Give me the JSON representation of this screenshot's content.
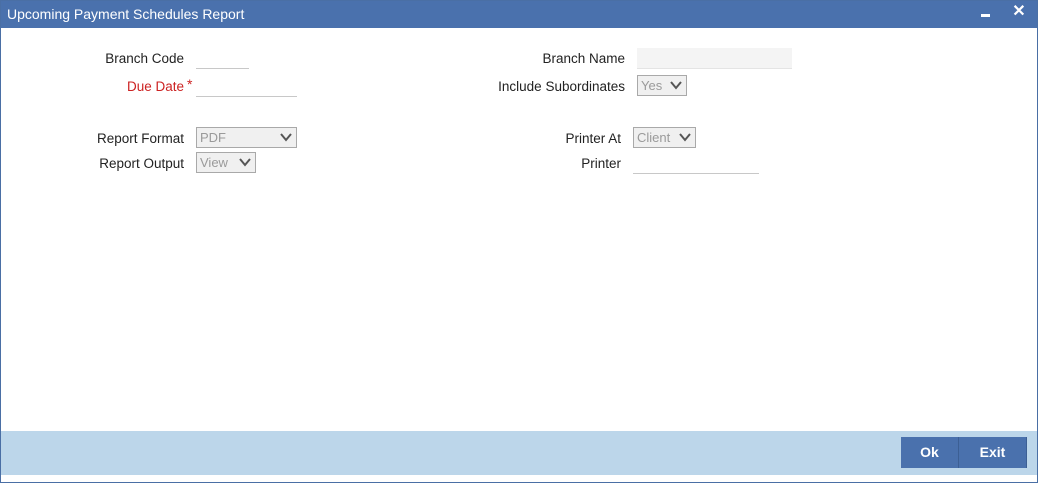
{
  "window": {
    "title": "Upcoming Payment Schedules Report",
    "minimize_icon": "minimize-icon",
    "close_icon": "close-icon",
    "close_glyph": "✕"
  },
  "form": {
    "branch_code": {
      "label": "Branch Code",
      "value": ""
    },
    "due_date": {
      "label": "Due Date",
      "required_marker": "*",
      "value": ""
    },
    "report_format": {
      "label": "Report Format",
      "selected": "PDF"
    },
    "report_output": {
      "label": "Report Output",
      "selected": "View"
    },
    "branch_name": {
      "label": "Branch Name",
      "value": ""
    },
    "include_subordinates": {
      "label": "Include Subordinates",
      "selected": "Yes"
    },
    "printer_at": {
      "label": "Printer At",
      "selected": "Client"
    },
    "printer": {
      "label": "Printer",
      "value": ""
    }
  },
  "footer": {
    "ok_label": "Ok",
    "exit_label": "Exit"
  },
  "colors": {
    "titlebar": "#4a71ad",
    "footer": "#bcd6ea",
    "required": "#cc2222",
    "button": "#4a71ad"
  }
}
